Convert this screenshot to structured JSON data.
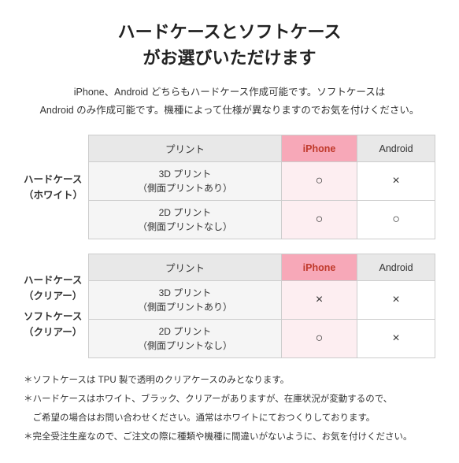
{
  "title": {
    "line1": "ハードケースとソフトケース",
    "line2": "がお選びいただけます"
  },
  "description": "iPhone、Android どちらもハードケース作成可能です。ソフトケースは\nAndroid のみ作成可能です。機種によって仕様が異なりますのでお気を付けください。",
  "table1": {
    "side_label_line1": "ハードケース",
    "side_label_line2": "（ホワイト）",
    "headers": [
      "プリント",
      "iPhone",
      "Android"
    ],
    "rows": [
      {
        "label_line1": "3D プリント",
        "label_line2": "（側面プリントあり）",
        "iphone": "○",
        "android": "×"
      },
      {
        "label_line1": "2D プリント",
        "label_line2": "（側面プリントなし）",
        "iphone": "○",
        "android": "○"
      }
    ]
  },
  "table2": {
    "side_label_line1": "ハードケース",
    "side_label_line2": "（クリアー）",
    "side_label2_line1": "ソフトケース",
    "side_label2_line2": "（クリアー）",
    "headers": [
      "プリント",
      "iPhone",
      "Android"
    ],
    "rows": [
      {
        "label_line1": "3D プリント",
        "label_line2": "（側面プリントあり）",
        "iphone": "×",
        "android": "×"
      },
      {
        "label_line1": "2D プリント",
        "label_line2": "（側面プリントなし）",
        "iphone": "○",
        "android": "×"
      }
    ]
  },
  "notes": [
    "＊ソフトケースは TPU 製で透明のクリアケースのみとなります。",
    "＊ハードケースはホワイト、ブラック、クリアーがありますが、在庫状況が変動するので、",
    "　ご希望の場合はお問い合わせください。通常はホワイトにておつくりしております。",
    "＊完全受注生産なので、ご注文の際に種類や機種に間違いがないように、お気を付けください。"
  ]
}
